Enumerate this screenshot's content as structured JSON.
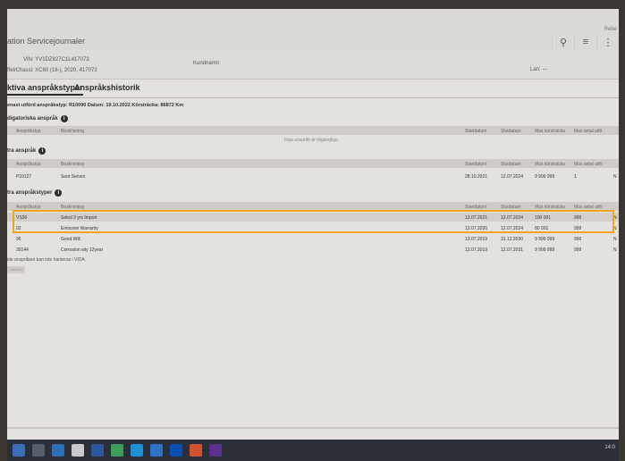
{
  "header": {
    "title": "ation  Servicejournaler",
    "user": "Rebe"
  },
  "toolbar": {
    "search_icon": "search-icon",
    "menu_icon": "hamburger-icon"
  },
  "vehicle": {
    "vin": "VIN: YV1DZ827C1L417073",
    "chassis": "ffel/Chassi: XC60 (18-), 2020, 417073",
    "kund": "Kundnamn",
    "lan": "Lan: ---"
  },
  "tabs": [
    {
      "label": "ktiva anspråkstyper"
    },
    {
      "label": "Anspråkshistorik"
    }
  ],
  "summary": "enast utförd anspråkstyp: R10090  Datum: 19.10.2022  Körsträcka: 86872 Km",
  "sections": {
    "mandatory": {
      "label": "digatoriska anspråk"
    },
    "other": {
      "label": "tra anspråk"
    },
    "extra": {
      "label": "tra anspråkstyper"
    }
  },
  "columns": {
    "type": "Anspråkstyp",
    "desc": "Beskrivning",
    "start": "Startdatum",
    "end": "Slutdatum",
    "maxkm": "Max körsträcka",
    "maxcount": "Max antal utfö",
    "last": "("
  },
  "empty_text": "Inga anspråk är tillgängliga",
  "other_rows": [
    {
      "type": "P10127",
      "desc": "Soot Sensor",
      "start": "28.10.2021",
      "end": "12.07.2024",
      "maxkm": "9 999 999",
      "maxcount": "1",
      "last": "N"
    }
  ],
  "extra_rows": [
    {
      "type": "VS36",
      "desc": "Seled 3 yrs Import",
      "start": "13.07.2021",
      "end": "12.07.2024",
      "maxkm": "100 001",
      "maxcount": "999",
      "last": "N"
    },
    {
      "type": "92",
      "desc": "Emission Warranty",
      "start": "13.07.2020",
      "end": "12.07.2024",
      "maxkm": "80 001",
      "maxcount": "999",
      "last": "N"
    },
    {
      "type": "96",
      "desc": "Good Will",
      "start": "13.07.2019",
      "end": "31.12.2030",
      "maxkm": "9 999 999",
      "maxcount": "999",
      "last": "N"
    },
    {
      "type": "30144",
      "desc": "Corrosion wty 12year",
      "start": "13.07.2019",
      "end": "12.07.2031",
      "maxkm": "9 999 999",
      "maxcount": "999",
      "last": "N"
    }
  ],
  "note": "ide anspråken kan inte hanteras i VIDA.",
  "button": "Tillbaka",
  "tray": {
    "clock": "14:0"
  }
}
